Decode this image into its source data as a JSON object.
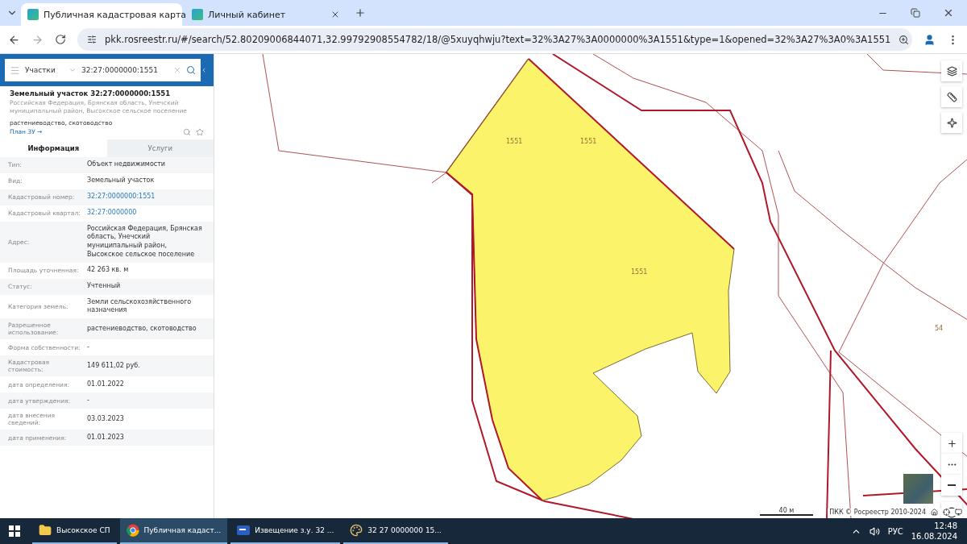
{
  "browser": {
    "tabs": [
      {
        "title": "Публичная кадастровая карта",
        "selected": true
      },
      {
        "title": "Личный кабинет",
        "selected": false
      }
    ],
    "url": "pkk.rosreestr.ru/#/search/52.80209006844071,32.99792908554782/18/@5xuyqhwju?text=32%3A27%3A0000000%3A1551&type=1&opened=32%3A27%3A0%3A1551"
  },
  "sidebar": {
    "search": {
      "category": "Участки",
      "value": "32:27:0000000:1551"
    },
    "title": "Земельный участок 32:27:0000000:1551",
    "address": "Российская Федерация, Брянская область, Унечский муниципальный район, Высокское сельское поселение",
    "usage": "растениеводство, скотоводство",
    "plan_link": "План ЗУ →",
    "tabs": [
      {
        "label": "Информация",
        "selected": true
      },
      {
        "label": "Услуги",
        "selected": false
      }
    ],
    "rows": [
      {
        "label": "Тип:",
        "value": "Объект недвижимости",
        "kind": "text"
      },
      {
        "label": "Вид:",
        "value": "Земельный участок",
        "kind": "text"
      },
      {
        "label": "Кадастровый номер:",
        "value": "32:27:0000000:1551",
        "kind": "link"
      },
      {
        "label": "Кадастровый квартал:",
        "value": "32:27:0000000",
        "kind": "link"
      },
      {
        "label": "Адрес:",
        "value": "Российская Федерация, Брянская область, Унечский муниципальный район, Высокское сельское поселение",
        "kind": "text"
      },
      {
        "label": "Площадь уточненная:",
        "value": "42 263 кв. м",
        "kind": "text"
      },
      {
        "label": "Статус:",
        "value": "Учтенный",
        "kind": "text"
      },
      {
        "label": "Категория земель:",
        "value": "Земли сельскохозяйственного назначения",
        "kind": "text"
      },
      {
        "label": "Разрешенное использование:",
        "value": "растениеводство, скотоводство",
        "kind": "text"
      },
      {
        "label": "Форма собственности:",
        "value": "-",
        "kind": "text"
      },
      {
        "label": "Кадастровая стоимость:",
        "value": "149 611,02 руб.",
        "kind": "text"
      },
      {
        "label": "дата определения:",
        "value": "01.01.2022",
        "kind": "text"
      },
      {
        "label": "дата утверждения:",
        "value": "-",
        "kind": "text"
      },
      {
        "label": "дата внесения сведений:",
        "value": "03.03.2023",
        "kind": "text"
      },
      {
        "label": "дата применения:",
        "value": "01.01.2023",
        "kind": "text"
      }
    ]
  },
  "map": {
    "labels": [
      "1551",
      "1551",
      "1551",
      "54"
    ],
    "scale": "40 м",
    "attribution": "ПКК © Росреестр 2010-2024"
  },
  "taskbar": {
    "items": [
      {
        "label": "Высокское СП",
        "kind": "folder",
        "active": false
      },
      {
        "label": "Публичная кадаст...",
        "kind": "browser",
        "active": true
      },
      {
        "label": "Извещение з.у. 32 ...",
        "kind": "word",
        "active": false
      },
      {
        "label": "32  27  0000000  15...",
        "kind": "paint",
        "active": false
      }
    ],
    "language": "РУС",
    "time": "12:48",
    "date": "16.08.2024"
  }
}
